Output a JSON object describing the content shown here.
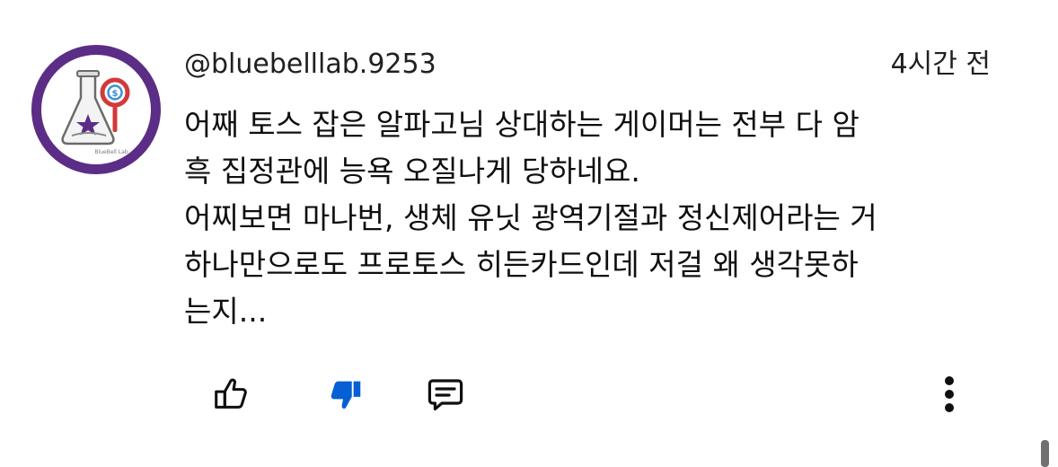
{
  "comment": {
    "author": "@bluebelllab.9253",
    "time": "4시간 전",
    "lines": [
      "어째 토스 잡은 알파고님 상대하는 게이머는 전부 다 암",
      "흑 집정관에 능욕 오질나게 당하네요.",
      "어찌보면 마나번, 생체 유닛 광역기절과 정신제어라는 거",
      "하나만으로도 프로토스 히든카드인데 저걸 왜 생각못하",
      "는지..."
    ]
  },
  "avatar": {
    "icon": "flask-magnifier-logo",
    "ring_color": "#5b2d86",
    "text": "BlueBell Lab"
  },
  "actions": {
    "like_icon": "thumbs-up-outline-icon",
    "dislike_icon": "thumbs-down-filled-icon",
    "reply_icon": "comment-icon",
    "more_icon": "more-vertical-icon",
    "dislike_color": "#065fd4"
  }
}
